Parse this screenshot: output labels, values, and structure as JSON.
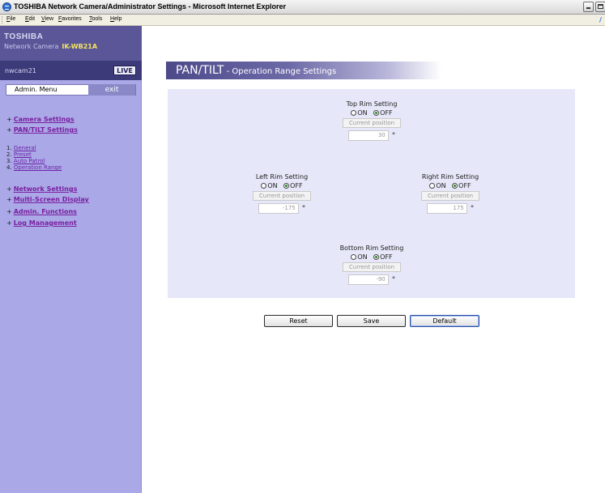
{
  "window": {
    "title": "TOSHIBA Network Camera/Administrator Settings - Microsoft Internet Explorer",
    "menu": [
      "File",
      "Edit",
      "View",
      "Favorites",
      "Tools",
      "Help"
    ]
  },
  "sidebar": {
    "brand": "TOSHIBA",
    "product": "Network Camera",
    "model": "IK-WB21A",
    "camera_name": "nwcam21",
    "live_label": "LIVE",
    "admin_menu_label": "Admin. Menu",
    "exit_label": "exit",
    "nav": {
      "camera_settings": "Camera Settings",
      "pan_tilt_settings": "PAN/TILT Settings",
      "sub": [
        {
          "num": "1.",
          "label": "General"
        },
        {
          "num": "2.",
          "label": "Preset"
        },
        {
          "num": "3.",
          "label": "Auto Patrol"
        },
        {
          "num": "4.",
          "label": "Operation Range"
        }
      ],
      "network_settings": "Network Settings",
      "multi_screen_display": "Multi-Screen Display",
      "admin_functions": "Admin. Functions",
      "log_management": "Log Management"
    }
  },
  "page": {
    "title_main": "PAN/TILT",
    "title_sub": " - Operation Range Settings"
  },
  "rims": {
    "on_label": "ON",
    "off_label": "OFF",
    "current_position_label": "Current position",
    "degree_symbol": "°",
    "top": {
      "title": "Top Rim Setting",
      "selected": "OFF",
      "value": "30"
    },
    "left": {
      "title": "Left Rim Setting",
      "selected": "OFF",
      "value": "-175"
    },
    "right": {
      "title": "Right Rim Setting",
      "selected": "OFF",
      "value": "175"
    },
    "bottom": {
      "title": "Bottom Rim Setting",
      "selected": "OFF",
      "value": "-90"
    }
  },
  "actions": {
    "reset": "Reset",
    "save": "Save",
    "default": "Default"
  }
}
